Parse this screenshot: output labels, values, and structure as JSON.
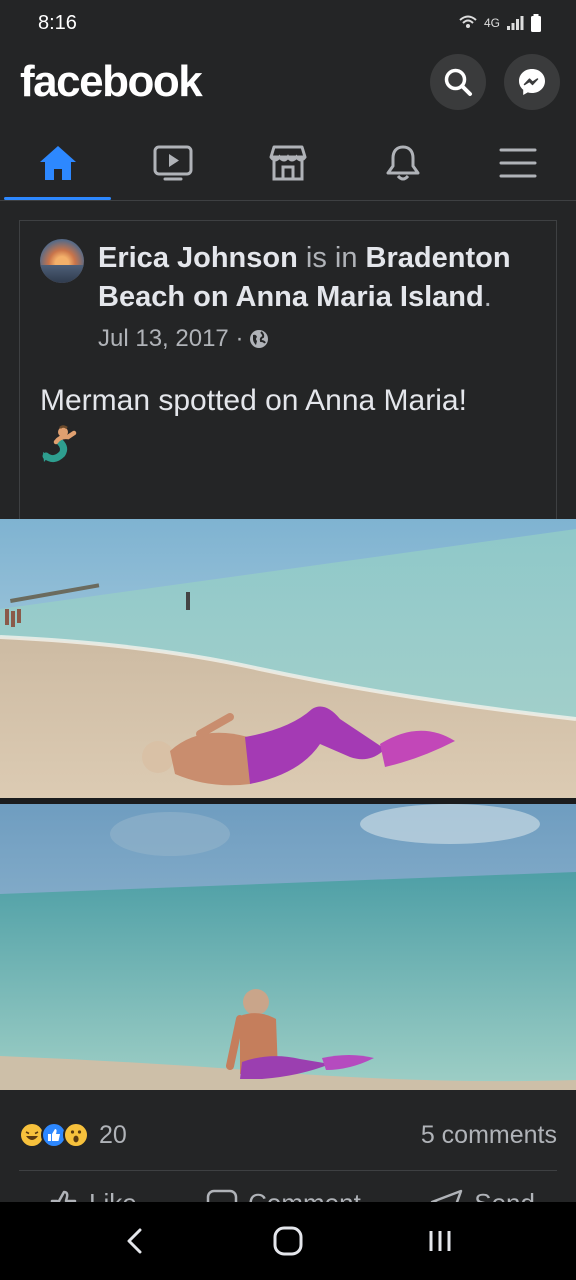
{
  "status": {
    "time": "8:16",
    "network": "4G"
  },
  "appbar": {
    "logo": "facebook"
  },
  "tabs": [
    {
      "name": "home-icon",
      "active": true
    },
    {
      "name": "video-icon",
      "active": false
    },
    {
      "name": "marketplace-icon",
      "active": false
    },
    {
      "name": "bell-icon",
      "active": false
    },
    {
      "name": "menu-icon",
      "active": false
    }
  ],
  "post": {
    "author": "Erica Johnson",
    "is_in": "is in",
    "location": "Bradenton Beach on Anna Maria Island",
    "location_suffix": ".",
    "date": "Jul 13, 2017 ·",
    "privacy_icon": "globe-icon",
    "text": "Merman spotted on Anna Maria!",
    "emoji": "merman-emoji"
  },
  "engagement": {
    "reaction_icons": [
      "laughing-emoji",
      "like-icon",
      "wow-emoji"
    ],
    "reaction_count": "20",
    "comments": "5 comments"
  },
  "actions": {
    "like": "Like",
    "comment": "Comment",
    "send": "Send"
  },
  "colors": {
    "accent": "#2d88ff",
    "background": "#242526",
    "surface": "#3a3b3c"
  }
}
